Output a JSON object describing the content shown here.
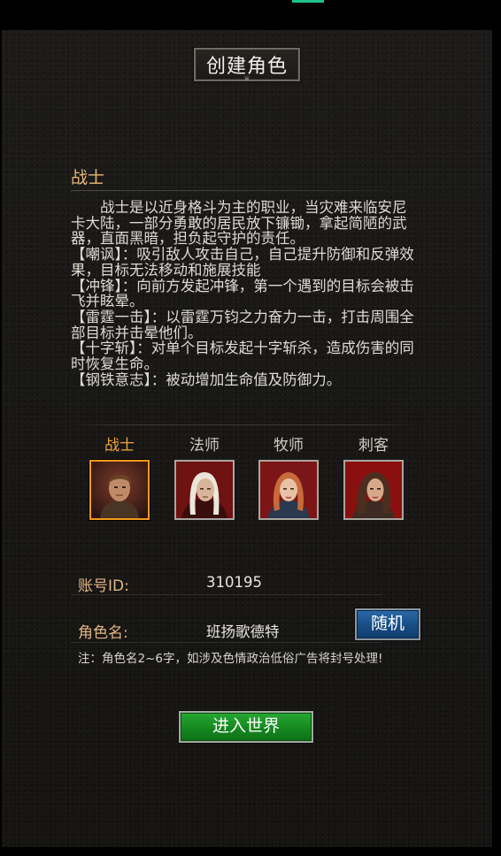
{
  "header": {
    "title": "创建角色"
  },
  "selected_class": {
    "name": "战士",
    "description": [
      "战士是以近身格斗为主的职业，当灾难来临安尼卡大陆，一部分勇敢的居民放下镰锄，拿起简陋的武器，直面黑暗，担负起守护的责任。",
      "【嘲讽】：吸引敌人攻击自己，自己提升防御和反弹效果，目标无法移动和施展技能",
      "【冲锋】：向前方发起冲锋，第一个遇到的目标会被击飞并眩晕。",
      "【雷霆一击】：以雷霆万钧之力奋力一击，打击周围全部目标并击晕他们。",
      "【十字斩】：对单个目标发起十字斩杀，造成伤害的同时恢复生命。",
      "【钢铁意志】：被动增加生命值及防御力。"
    ]
  },
  "classes": [
    {
      "name": "战士",
      "portrait": "warrior-portrait",
      "selected": true
    },
    {
      "name": "法师",
      "portrait": "mage-portrait",
      "selected": false
    },
    {
      "name": "牧师",
      "portrait": "priest-portrait",
      "selected": false
    },
    {
      "name": "刺客",
      "portrait": "assassin-portrait",
      "selected": false
    }
  ],
  "form": {
    "account_label": "账号ID:",
    "account_value": "310195",
    "name_label": "角色名:",
    "name_value": "班扬歌德特",
    "random_label": "随机",
    "note": "注：角色名2~6字，如涉及色情政治低俗广告将封号处理!"
  },
  "actions": {
    "enter_label": "进入世界"
  },
  "colors": {
    "heading": "#e6b877",
    "selected_class": "#f0a43a",
    "random_button": "#174c84",
    "enter_button": "#15881f"
  }
}
